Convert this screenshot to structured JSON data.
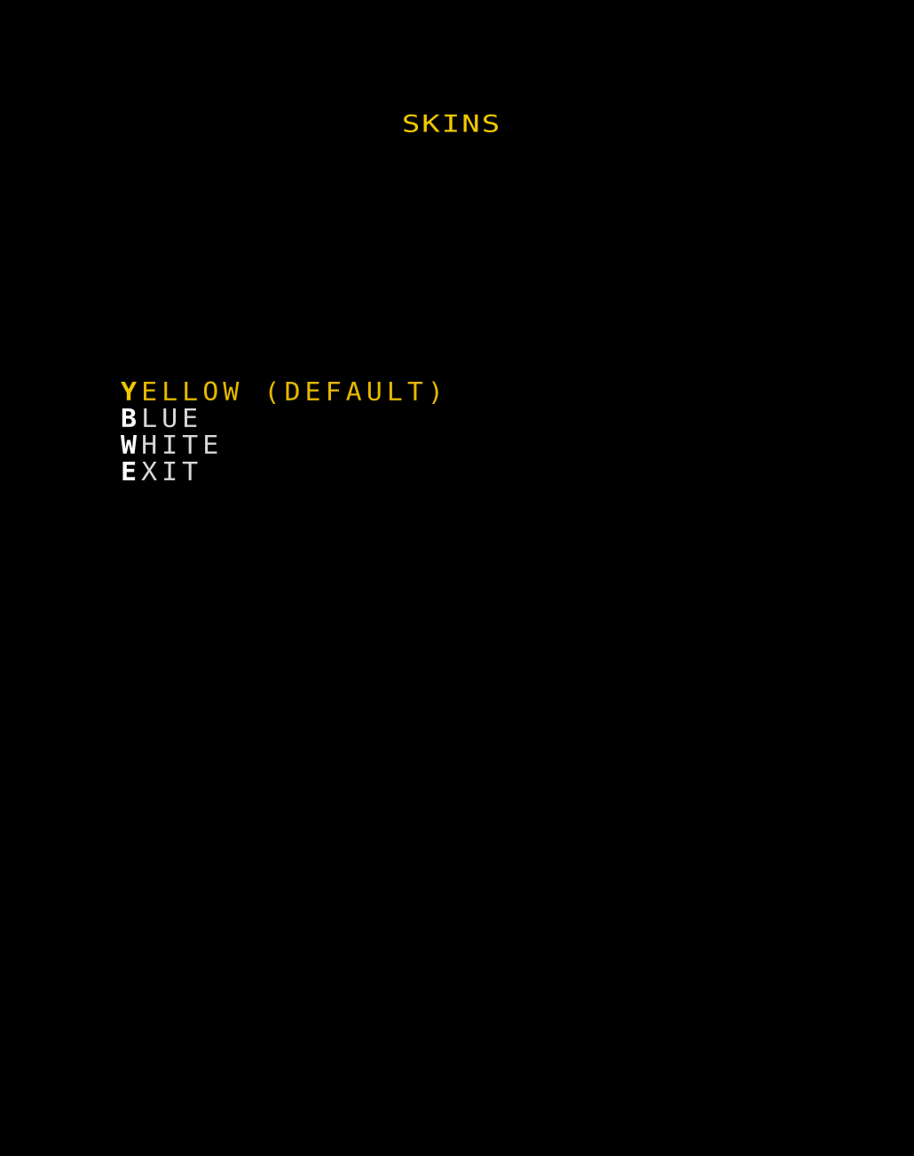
{
  "screen": {
    "title": "SKINS"
  },
  "menu": {
    "items": [
      {
        "initial": "Y",
        "rest": "ELLOW (DEFAULT)",
        "selected": true
      },
      {
        "initial": "B",
        "rest": "LUE",
        "selected": false
      },
      {
        "initial": "W",
        "rest": "HITE",
        "selected": false
      },
      {
        "initial": "E",
        "rest": "XIT",
        "selected": false
      }
    ]
  },
  "colors": {
    "background": "#000000",
    "highlight": "#f0c800",
    "normal_text": "#d8d8d8",
    "initial_text": "#ffffff"
  }
}
